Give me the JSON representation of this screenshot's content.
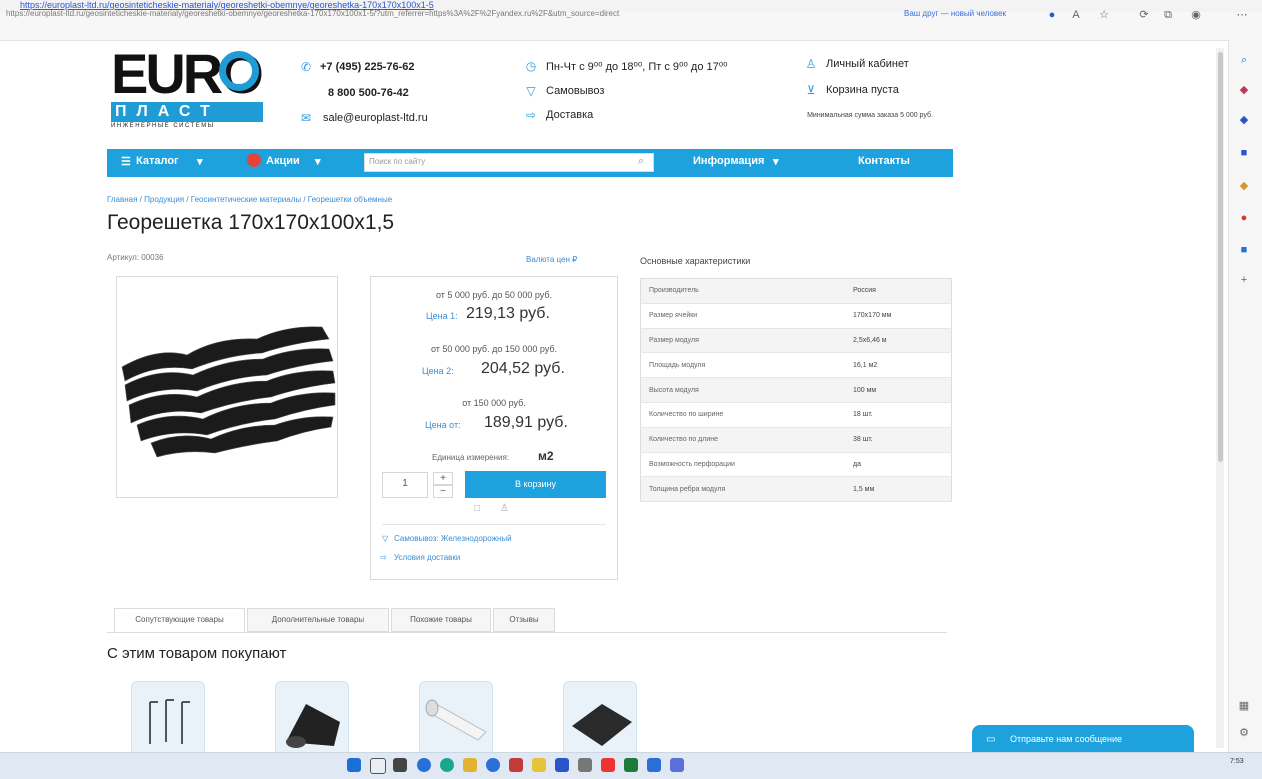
{
  "browser": {
    "bookmarks_text": "https://europlast-ltd.ru/geosinteticheskie-materialy/georeshetki-obemnye/georeshetka-170x170x100x1-5",
    "url": "https://europlast-ltd.ru/geosinteticheskie-materialy/georeshetki-obemnye/georeshetka-170x170x100x1-5/?utm_referrer=https%3A%2F%2Fyandex.ru%2F&utm_source=direct",
    "suggest": "Ваш друг — новый человек"
  },
  "header": {
    "logo_top": "EURO",
    "logo_mid": "ПЛАСТ",
    "logo_sub": "ИНЖЕНЕРНЫЕ СИСТЕМЫ",
    "phone1": "+7 (495) 225-76-62",
    "phone2": "8 800 500-76-42",
    "email": "sale@europlast-ltd.ru",
    "hours": "Пн-Чт с 9⁰⁰ до 18⁰⁰, Пт с 9⁰⁰ до 17⁰⁰",
    "pickup": "Самовывоз",
    "delivery": "Доставка",
    "account": "Личный кабинет",
    "cart": "Корзина пуста",
    "min_sum": "Минимальная сумма заказа 5 000 руб."
  },
  "nav": {
    "catalog": "Каталог",
    "sales": "Акции",
    "search_placeholder": "Поиск по сайту",
    "info": "Информация",
    "contacts": "Контакты"
  },
  "product": {
    "breadcrumb": "Главная / Продукция / Геосинтетические материалы / Георешетки объемные",
    "title": "Георешетка 170х170х100х1,5",
    "sku": "Артикул: 00036",
    "currency_link": "Валюта цен ₽",
    "prices": [
      {
        "range": "от 5 000 руб. до 50 000 руб.",
        "label": "Цена 1:",
        "value": "219,13 руб."
      },
      {
        "range": "от 50 000 руб. до 150 000 руб.",
        "label": "Цена 2:",
        "value": "204,52 руб."
      },
      {
        "range": "от 150 000 руб.",
        "label": "Цена от:",
        "value": "189,91 руб."
      }
    ],
    "unit_label": "Единица измерения:",
    "unit_value": "м2",
    "qty": "1",
    "cart_button": "В корзину",
    "pickup_link": "Самовывоз: Железнодорожный",
    "delivery_link": "Условия доставки"
  },
  "specs": {
    "title": "Основные характеристики",
    "rows": [
      {
        "name": "Производитель",
        "value": "Россия"
      },
      {
        "name": "Размер ячейки",
        "value": "170х170 мм"
      },
      {
        "name": "Размер модуля",
        "value": "2,5х6,46 м"
      },
      {
        "name": "Площадь модуля",
        "value": "16,1 м2"
      },
      {
        "name": "Высота модуля",
        "value": "100 мм"
      },
      {
        "name": "Количество по ширине",
        "value": "18 шт."
      },
      {
        "name": "Количество по длине",
        "value": "38 шт."
      },
      {
        "name": "Возможность перфорации",
        "value": "да"
      },
      {
        "name": "Толщина ребра модуля",
        "value": "1,5 мм"
      }
    ]
  },
  "tabs": [
    "Сопутствующие товары",
    "Дополнительные товары",
    "Похожие товары",
    "Отзывы"
  ],
  "related_title": "С этим товаром покупают",
  "chat": {
    "label": "Отправьте нам сообщение"
  },
  "taskbar": {
    "clock": "7:53"
  },
  "colors": {
    "brand_blue": "#1ea2de",
    "link_blue": "#3a8ed6"
  }
}
